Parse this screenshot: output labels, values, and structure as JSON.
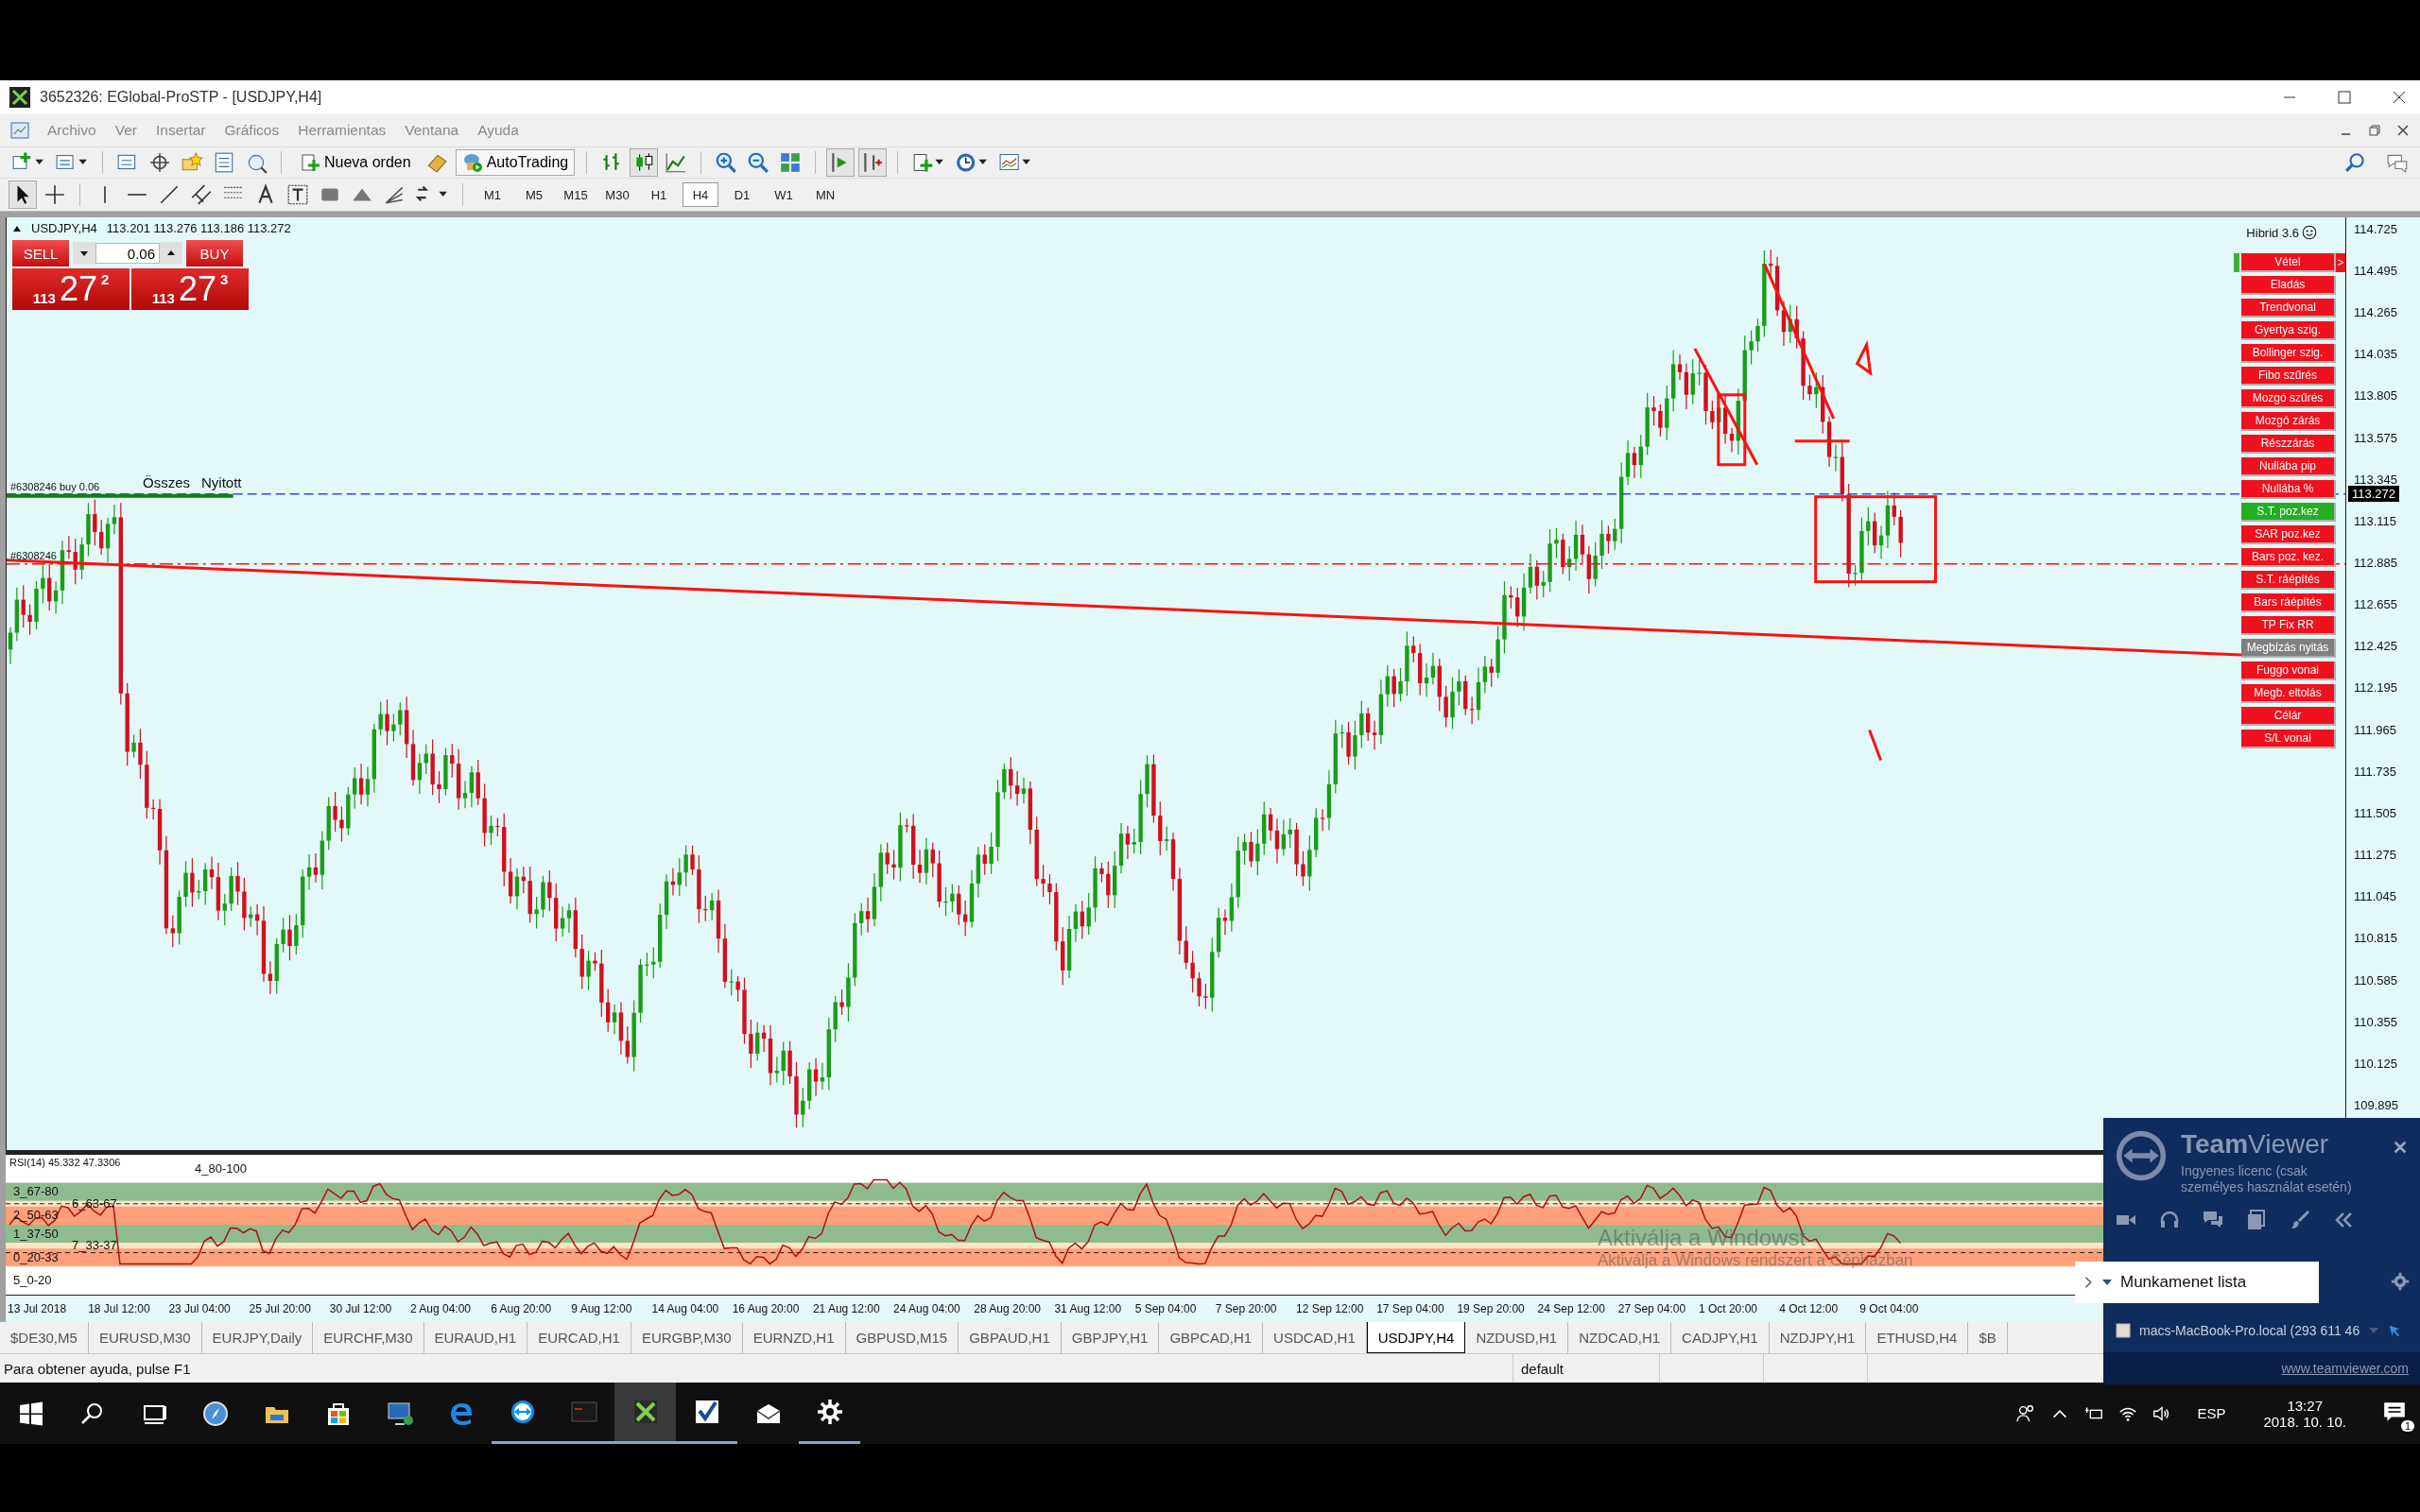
{
  "window": {
    "title": "3652326: EGlobal-ProSTP - [USDJPY,H4]"
  },
  "menu": [
    "Archivo",
    "Ver",
    "Insertar",
    "Gráficos",
    "Herramientas",
    "Ventana",
    "Ayuda"
  ],
  "toolbar": {
    "new_order": "Nueva orden",
    "autotrading": "AutoTrading"
  },
  "timeframes": [
    {
      "label": "M1",
      "selected": false
    },
    {
      "label": "M5",
      "selected": false
    },
    {
      "label": "M15",
      "selected": false
    },
    {
      "label": "M30",
      "selected": false
    },
    {
      "label": "H1",
      "selected": false
    },
    {
      "label": "H4",
      "selected": true
    },
    {
      "label": "D1",
      "selected": false
    },
    {
      "label": "W1",
      "selected": false
    },
    {
      "label": "MN",
      "selected": false
    }
  ],
  "chart": {
    "symbol": "USDJPY,H4",
    "ohlc": "113.201 113.276 113.186 113.272",
    "trade_panel": {
      "sell": "SELL",
      "buy": "BUY",
      "lots": "0.06",
      "sell_price": {
        "big": "113",
        "pips": "27",
        "point": "2"
      },
      "buy_price": {
        "big": "113",
        "pips": "27",
        "point": "3"
      }
    },
    "order_labels": [
      "#6308246 buy 0.06",
      "#6308246"
    ],
    "order_filters": [
      "Összes",
      "Nyitott"
    ],
    "expert": "Hibrid 3.6",
    "panel_buttons": [
      {
        "label": "Vétel",
        "color": "#f0101e",
        "suffix": ">"
      },
      {
        "label": "Eladás",
        "color": "#f0101e"
      },
      {
        "label": "Trendvonal",
        "color": "#f0101e"
      },
      {
        "label": "Gyertya szig.",
        "color": "#f0101e"
      },
      {
        "label": "Bollinger szig.",
        "color": "#f0101e"
      },
      {
        "label": "Fibo szűrés",
        "color": "#f0101e"
      },
      {
        "label": "Mozgó szűrés",
        "color": "#f0101e"
      },
      {
        "label": "Mozgó zárás",
        "color": "#f0101e"
      },
      {
        "label": "Részzárás",
        "color": "#f0101e"
      },
      {
        "label": "Nullába pip",
        "color": "#f0101e"
      },
      {
        "label": "Nullába %",
        "color": "#f0101e"
      },
      {
        "label": "S.T. poz.kez",
        "color": "#22b022"
      },
      {
        "label": "SAR poz.kez",
        "color": "#f0101e"
      },
      {
        "label": "Bars poz. kez.",
        "color": "#f0101e"
      },
      {
        "label": "S.T. ráépítés",
        "color": "#f0101e"
      },
      {
        "label": "Bars ráépítés",
        "color": "#f0101e"
      },
      {
        "label": "TP Fix RR",
        "color": "#f0101e"
      },
      {
        "label": "Megbízás nyitás",
        "color": "#808080"
      },
      {
        "label": "Fuggo vonai",
        "color": "#f0101e"
      },
      {
        "label": "Megb. eltolás",
        "color": "#f0101e"
      },
      {
        "label": "Célár",
        "color": "#f0101e"
      },
      {
        "label": "S/L vonal",
        "color": "#f0101e"
      }
    ],
    "price_axis": [
      "114.725",
      "114.495",
      "114.265",
      "114.035",
      "113.805",
      "113.575",
      "113.345",
      "113.115",
      "112.885",
      "112.655",
      "112.425",
      "112.195",
      "111.965",
      "111.735",
      "111.505",
      "111.275",
      "111.045",
      "110.815",
      "110.585",
      "110.355",
      "110.125",
      "109.895"
    ],
    "current_price": "113.272"
  },
  "rsi": {
    "title": "RSI(14) 45.332  47.3306",
    "bands": [
      {
        "label": "4_80-100",
        "color": "#ffffff"
      },
      {
        "label": "3_67-80",
        "color": "#8fbc8f"
      },
      {
        "label": "6_63-67",
        "color": "#ffe4c4"
      },
      {
        "label": "2_50-63",
        "color": "#ffa07a"
      },
      {
        "label": "1_37-50",
        "color": "#8fbc8f"
      },
      {
        "label": "7_33-37",
        "color": "#ffe4c4"
      },
      {
        "label": "0_20-33",
        "color": "#ffa07a"
      },
      {
        "label": "5_0-20",
        "color": "#ffffff"
      }
    ]
  },
  "time_axis": [
    "13 Jul 2018",
    "18 Jul 12:00",
    "23 Jul 04:00",
    "25 Jul 20:00",
    "30 Jul 12:00",
    "2 Aug 04:00",
    "6 Aug 20:00",
    "9 Aug 12:00",
    "14 Aug 04:00",
    "16 Aug 20:00",
    "21 Aug 12:00",
    "24 Aug 04:00",
    "28 Aug 20:00",
    "31 Aug 12:00",
    "5 Sep 04:00",
    "7 Sep 20:00",
    "12 Sep 12:00",
    "17 Sep 04:00",
    "19 Sep 20:00",
    "24 Sep 12:00",
    "27 Sep 04:00",
    "1 Oct 20:00",
    "4 Oct 12:00",
    "9 Oct 04:00"
  ],
  "tabs": [
    {
      "label": "$DE30,M5",
      "selected": false
    },
    {
      "label": "EURUSD,M30",
      "selected": false
    },
    {
      "label": "EURJPY,Daily",
      "selected": false
    },
    {
      "label": "EURCHF,M30",
      "selected": false
    },
    {
      "label": "EURAUD,H1",
      "selected": false
    },
    {
      "label": "EURCAD,H1",
      "selected": false
    },
    {
      "label": "EURGBP,M30",
      "selected": false
    },
    {
      "label": "EURNZD,H1",
      "selected": false
    },
    {
      "label": "GBPUSD,M15",
      "selected": false
    },
    {
      "label": "GBPAUD,H1",
      "selected": false
    },
    {
      "label": "GBPJPY,H1",
      "selected": false
    },
    {
      "label": "GBPCAD,H1",
      "selected": false
    },
    {
      "label": "USDCAD,H1",
      "selected": false
    },
    {
      "label": "USDJPY,H4",
      "selected": true
    },
    {
      "label": "NZDUSD,H1",
      "selected": false
    },
    {
      "label": "NZDCAD,H1",
      "selected": false
    },
    {
      "label": "CADJPY,H1",
      "selected": false
    },
    {
      "label": "NZDJPY,H1",
      "selected": false
    },
    {
      "label": "ETHUSD,H4",
      "selected": false
    },
    {
      "label": "$B",
      "selected": false
    }
  ],
  "status_bar": {
    "help": "Para obtener ayuda, pulse F1",
    "profile": "default"
  },
  "windows_activation": {
    "title": "Aktiválja a Windowst",
    "subtitle": "Aktiválja a Windows rendszert a Gépházban"
  },
  "teamviewer": {
    "brand_a": "Team",
    "brand_b": "Viewer",
    "license": "Ingyenes licenc (csak személyes használat esetén)",
    "session_list": "Munkamenet lista",
    "session": "macs-MacBook-Pro.local (293 611 46",
    "link": "www.teamviewer.com"
  },
  "taskbar": {
    "language": "ESP",
    "time": "13:27",
    "date": "2018. 10. 10.",
    "notifications": "1"
  }
}
